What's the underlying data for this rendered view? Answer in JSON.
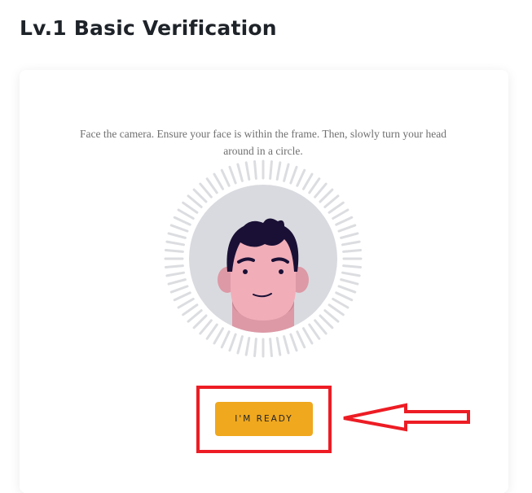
{
  "page": {
    "title": "Lv.1 Basic Verification"
  },
  "verification": {
    "instruction": "Face the camera. Ensure your face is within the frame. Then, slowly turn your head around in a circle.",
    "ready_button": "I'M READY"
  },
  "colors": {
    "accent": "#f0a81e",
    "annotation": "#ed1c24",
    "tick": "#dcdde0",
    "face_bg": "#d9dadf"
  },
  "icons": {
    "illustration": "face-illustration-icon",
    "annotation": "arrow-left-icon"
  }
}
